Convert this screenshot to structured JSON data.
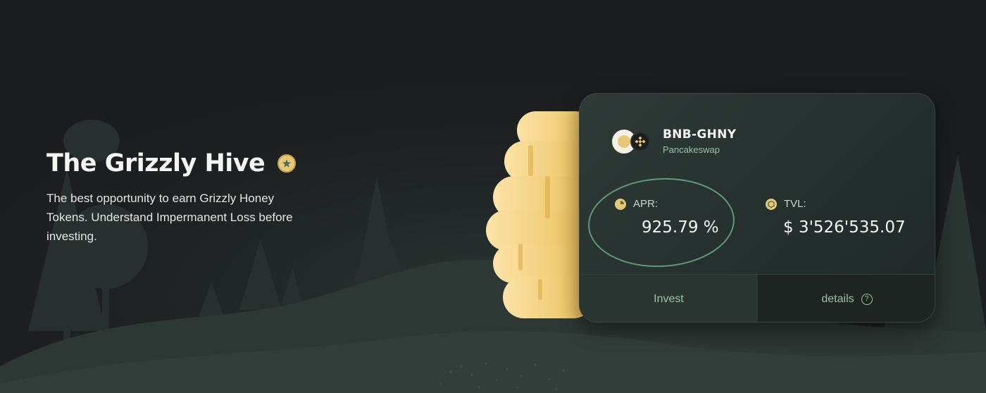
{
  "hero": {
    "title": "The Grizzly Hive",
    "badge_icon": "grizzly-badge-icon",
    "description": "The best opportunity to earn Grizzly Honey Tokens. Understand Impermanent Loss before investing."
  },
  "farm_card": {
    "pair_name": "BNB-GHNY",
    "dex": "Pancakeswap",
    "apr_label": "APR:",
    "apr_value": "925.79 %",
    "tvl_label": "TVL:",
    "tvl_value": "$ 3'526'535.07",
    "invest_label": "Invest",
    "details_label": "details",
    "help_icon_glyph": "?"
  },
  "colors": {
    "background": "#1b1c1e",
    "honey": "#e8c776",
    "accent_green": "#9fc3a6",
    "highlight_ring": "#5f9a78"
  }
}
